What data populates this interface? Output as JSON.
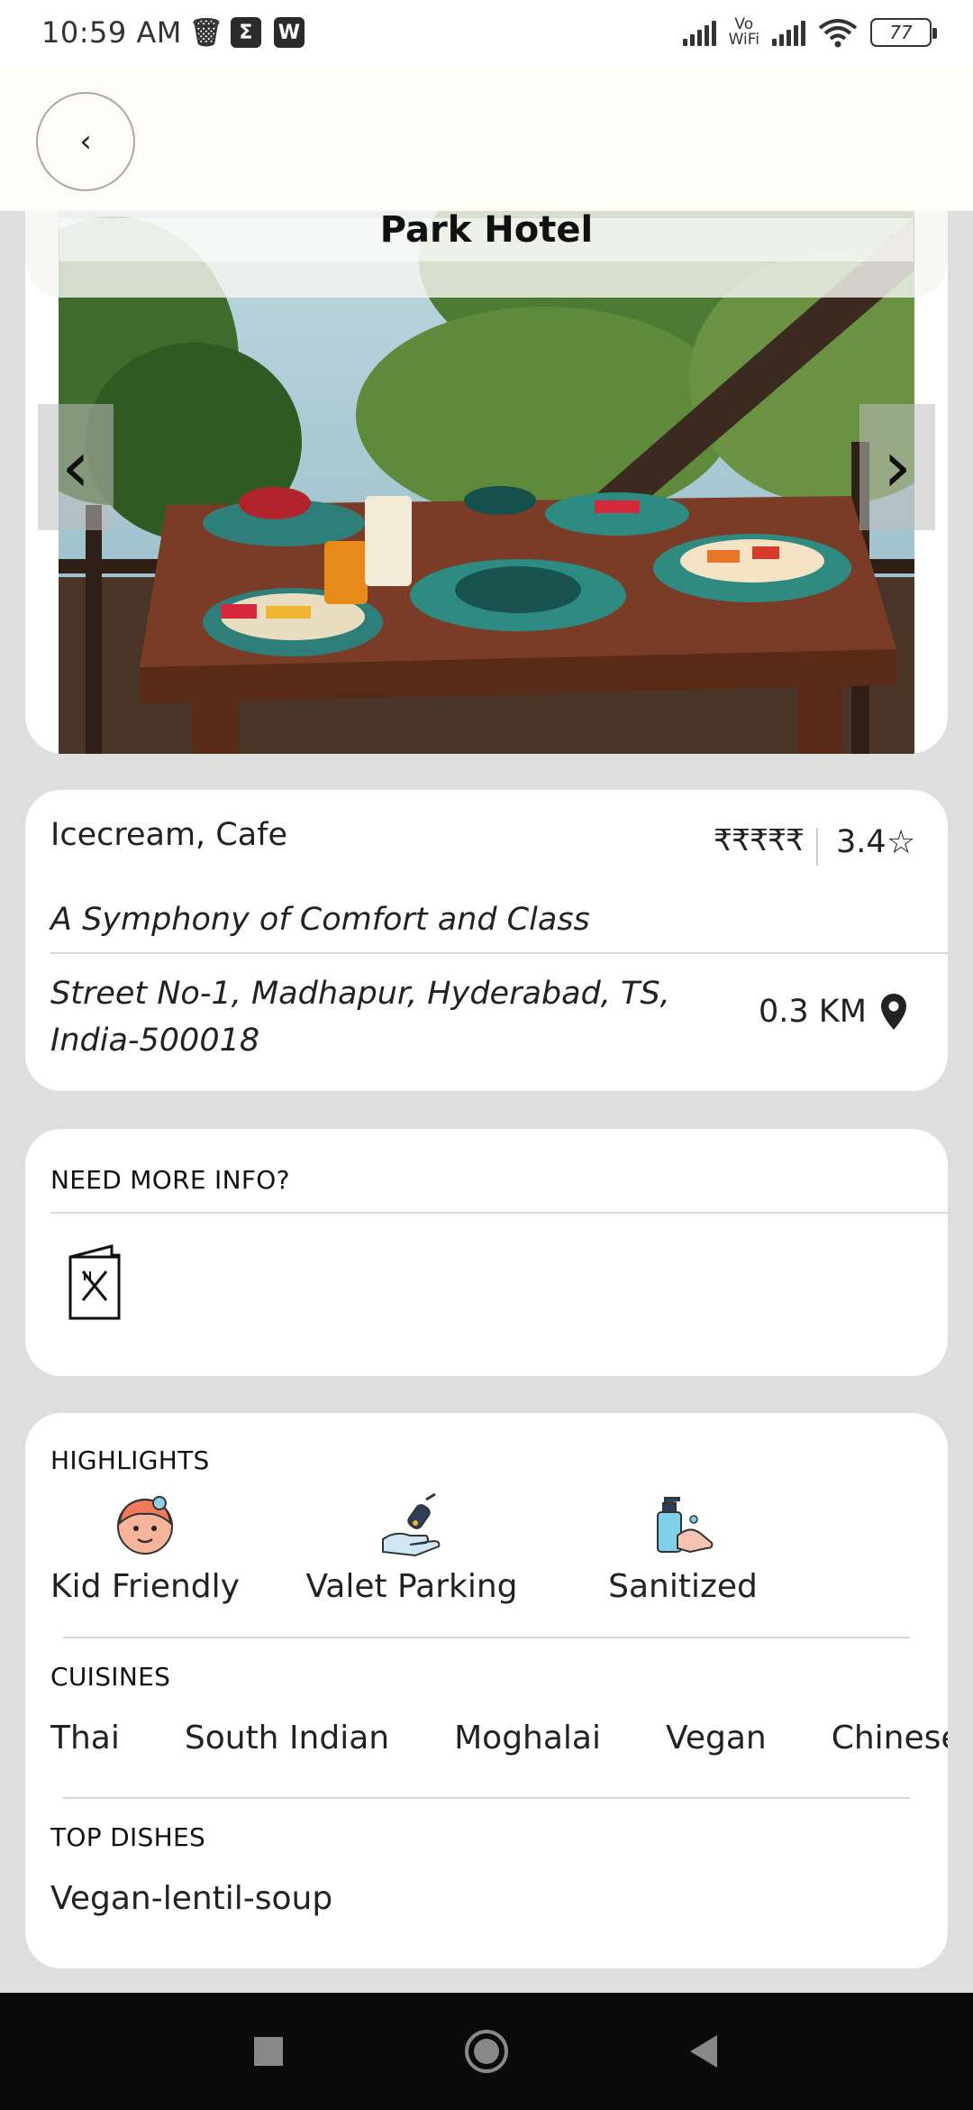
{
  "status_bar": {
    "time": "10:59 AM",
    "notif_icons": [
      "trash-icon",
      "sigma-app-icon",
      "wps-app-icon"
    ],
    "vowifi_top": "Vo",
    "vowifi_bottom": "WiFi",
    "battery": "77"
  },
  "header": {
    "back_icon": "chevron-left-icon",
    "back_glyph": "‹"
  },
  "hotel": {
    "name": "Park Hotel",
    "categories": "Icecream, Cafe",
    "price_level": "₹₹₹₹₹",
    "rating": "3.4",
    "rating_icon": "star-outline-icon",
    "tagline": "A Symphony of Comfort and Class",
    "address": "Street No-1, Madhapur, Hyderabad, TS, India-500018",
    "distance": "0.3 KM",
    "distance_icon": "location-pin-icon"
  },
  "carousel": {
    "prev_glyph": "‹",
    "next_glyph": "›"
  },
  "more_info": {
    "label": "NEED MORE INFO?",
    "menu_icon": "menu-card-icon"
  },
  "highlights": {
    "label": "HIGHLIGHTS",
    "items": [
      {
        "label": "Kid Friendly",
        "icon": "kid-face-icon"
      },
      {
        "label": "Valet Parking",
        "icon": "car-key-hand-icon"
      },
      {
        "label": "Sanitized",
        "icon": "sanitizer-hand-icon"
      }
    ]
  },
  "cuisines": {
    "label": "CUISINES",
    "items": [
      "Thai",
      "South Indian",
      "Moghalai",
      "Vegan",
      "Chinese"
    ]
  },
  "top_dishes": {
    "label": "TOP DISHES",
    "items": [
      "Vegan-lentil-soup"
    ]
  },
  "nav": {
    "icons": [
      "recents-square-icon",
      "home-circle-icon",
      "back-triangle-icon"
    ]
  },
  "colors": {
    "card": "#ffffff",
    "page": "#dedede",
    "header": "#fdfcf7",
    "navbar": "#0a0a0a"
  }
}
